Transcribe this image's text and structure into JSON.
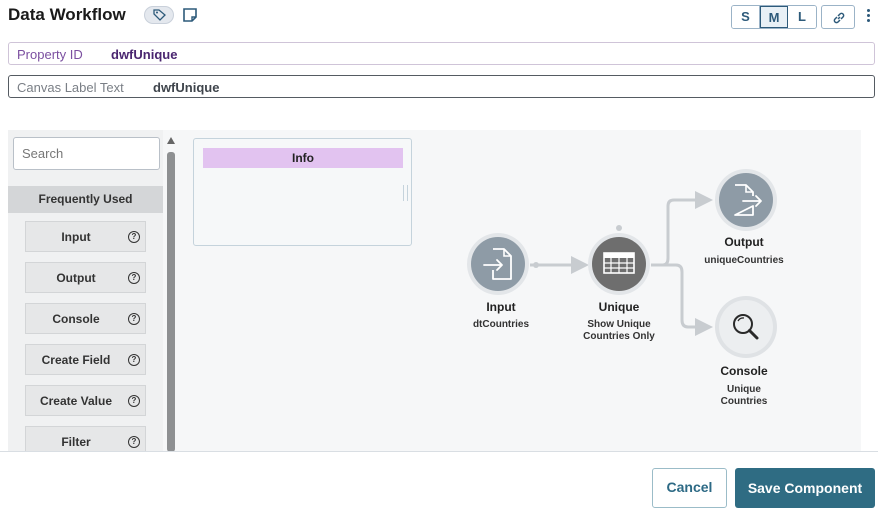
{
  "header": {
    "title": "Data Workflow",
    "sizes": [
      "S",
      "M",
      "L"
    ],
    "active_size": "M"
  },
  "properties": {
    "property_id_label": "Property ID",
    "property_id_value": "dwfUnique",
    "canvas_label_label": "Canvas Label Text",
    "canvas_label_value": "dwfUnique"
  },
  "palette": {
    "search_placeholder": "Search",
    "section_title": "Frequently Used",
    "items": [
      "Input",
      "Output",
      "Console",
      "Create Field",
      "Create Value",
      "Filter"
    ]
  },
  "info_box": {
    "title": "Info"
  },
  "nodes": {
    "input": {
      "title": "Input",
      "subtitle": "dtCountries"
    },
    "unique": {
      "title": "Unique",
      "subtitle_line1": "Show Unique",
      "subtitle_line2": "Countries Only"
    },
    "output": {
      "title": "Output",
      "subtitle": "uniqueCountries"
    },
    "console": {
      "title": "Console",
      "subtitle_line1": "Unique",
      "subtitle_line2": "Countries"
    }
  },
  "footer": {
    "cancel_label": "Cancel",
    "save_label": "Save Component"
  },
  "colors": {
    "accent": "#2f6c83",
    "node_light": "#8e9ba6",
    "node_dark": "#6e6e6e",
    "info_header": "#e2c3f0"
  }
}
